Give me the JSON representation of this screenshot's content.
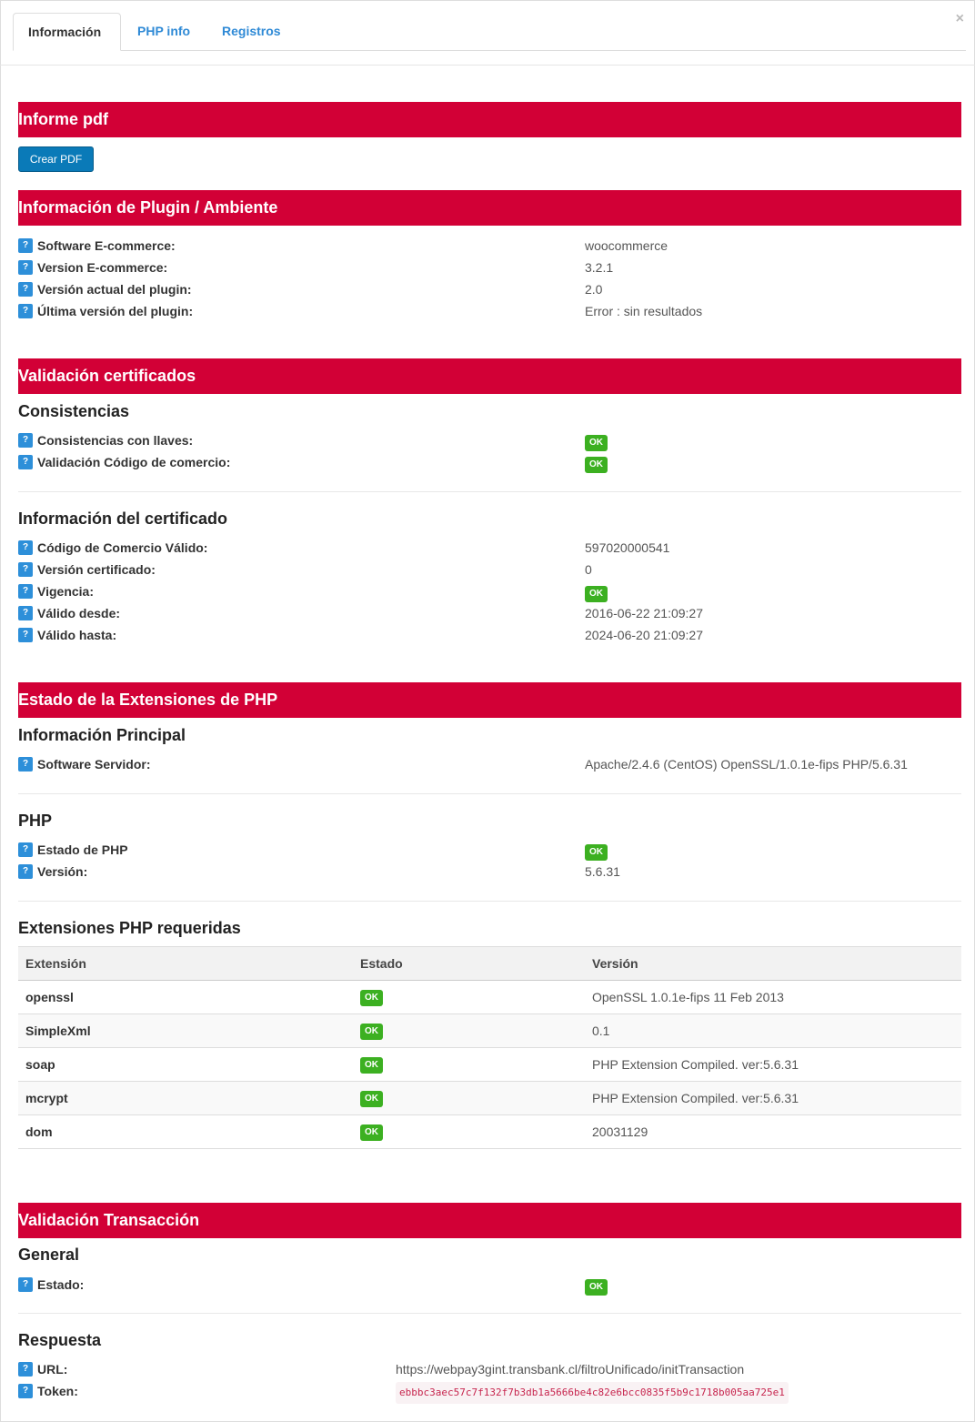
{
  "tabs": [
    {
      "label": "Información",
      "active": true
    },
    {
      "label": "PHP info",
      "active": false
    },
    {
      "label": "Registros",
      "active": false
    }
  ],
  "close_label": "×",
  "help_glyph": "?",
  "colors": {
    "section_bar": "#d20036",
    "ok_badge": "#3cb021",
    "help_icon": "#2d8fd9",
    "tab_link": "#2f8ad6",
    "pdf_button": "#0a7ab8"
  },
  "pdf": {
    "title": "Informe pdf",
    "button": "Crear PDF"
  },
  "plugin": {
    "title": "Información de Plugin / Ambiente",
    "rows": [
      {
        "label": "Software E-commerce:",
        "value": "woocommerce"
      },
      {
        "label": "Version E-commerce:",
        "value": "3.2.1"
      },
      {
        "label": "Versión actual del plugin:",
        "value": "2.0"
      },
      {
        "label": "Última versión del plugin:",
        "value": "Error : sin resultados"
      }
    ]
  },
  "certs": {
    "title": "Validación certificados",
    "consistencias": {
      "heading": "Consistencias",
      "rows": [
        {
          "label": "Consistencias con llaves:",
          "badge": "OK"
        },
        {
          "label": "Validación Código de comercio:",
          "badge": "OK"
        }
      ]
    },
    "info": {
      "heading": "Información del certificado",
      "rows": [
        {
          "label": "Código de Comercio Válido:",
          "value": "597020000541"
        },
        {
          "label": "Versión certificado:",
          "value": "0"
        },
        {
          "label": "Vigencia:",
          "badge": "OK"
        },
        {
          "label": "Válido desde:",
          "value": "2016-06-22 21:09:27"
        },
        {
          "label": "Válido hasta:",
          "value": "2024-06-20 21:09:27"
        }
      ]
    }
  },
  "php_ext": {
    "title": "Estado de la Extensiones de PHP",
    "principal": {
      "heading": "Información Principal",
      "rows": [
        {
          "label": "Software Servidor:",
          "value": "Apache/2.4.6 (CentOS) OpenSSL/1.0.1e-fips PHP/5.6.31"
        }
      ]
    },
    "php": {
      "heading": "PHP",
      "rows": [
        {
          "label": "Estado de PHP",
          "badge": "OK"
        },
        {
          "label": "Versión:",
          "value": "5.6.31"
        }
      ]
    },
    "required": {
      "heading": "Extensiones PHP requeridas",
      "columns": [
        "Extensión",
        "Estado",
        "Versión"
      ],
      "rows": [
        {
          "name": "openssl",
          "status": "OK",
          "version": "OpenSSL 1.0.1e-fips 11 Feb 2013"
        },
        {
          "name": "SimpleXml",
          "status": "OK",
          "version": "0.1"
        },
        {
          "name": "soap",
          "status": "OK",
          "version": "PHP Extension Compiled. ver:5.6.31"
        },
        {
          "name": "mcrypt",
          "status": "OK",
          "version": "PHP Extension Compiled. ver:5.6.31"
        },
        {
          "name": "dom",
          "status": "OK",
          "version": "20031129"
        }
      ]
    }
  },
  "transaction": {
    "title": "Validación Transacción",
    "general": {
      "heading": "General",
      "rows": [
        {
          "label": "Estado:",
          "badge": "OK"
        }
      ]
    },
    "respuesta": {
      "heading": "Respuesta",
      "url_label": "URL:",
      "url": "https://webpay3gint.transbank.cl/filtroUnificado/initTransaction",
      "token_label": "Token:",
      "token": "ebbbc3aec57c7f132f7b3db1a5666be4c82e6bcc0835f5b9c1718b005aa725e1"
    }
  }
}
